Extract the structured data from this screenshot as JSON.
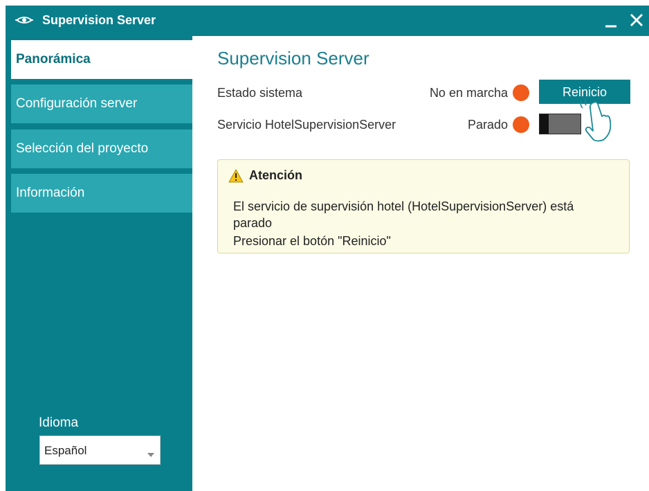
{
  "window": {
    "title": "Supervision Server",
    "minimize_symbol": "_",
    "close_symbol": "✕",
    "accent_color": "#0a7f8c"
  },
  "sidebar": {
    "items": [
      {
        "label": "Panorámica",
        "active": true
      },
      {
        "label": "Configuración server",
        "active": false
      },
      {
        "label": "Selección del proyecto",
        "active": false
      },
      {
        "label": "Información",
        "active": false
      }
    ],
    "language": {
      "label": "Idioma",
      "selected": "Español"
    }
  },
  "main": {
    "title": "Supervision Server",
    "rows": [
      {
        "label": "Estado sistema",
        "status": "No en marcha",
        "indicator_color": "#f05a1a",
        "action": "Reinicio"
      },
      {
        "label": "Servicio HotelSupervisionServer",
        "status": "Parado",
        "indicator_color": "#f05a1a",
        "toggle_on": false
      }
    ],
    "alert": {
      "title": "Atención",
      "lines": [
        "El servicio de supervisión hotel (HotelSupervisionServer) está",
        "parado",
        "Presionar el botón \"Reinicio\""
      ]
    }
  }
}
